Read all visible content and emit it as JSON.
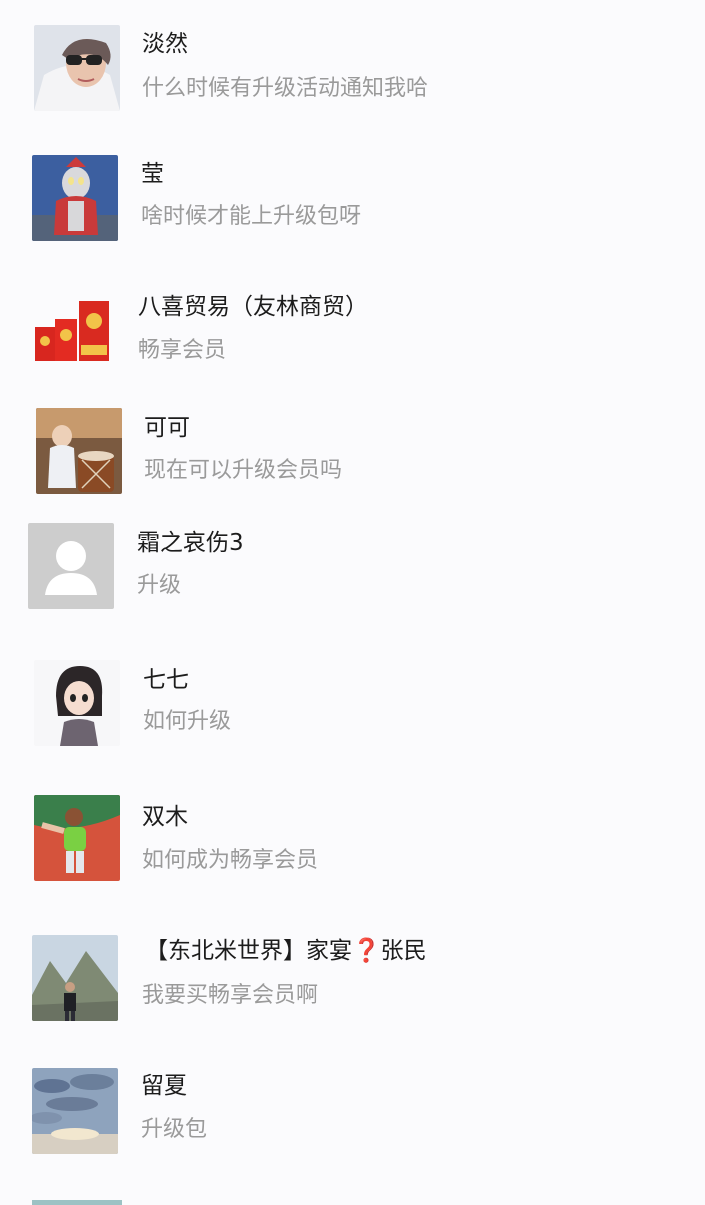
{
  "messages": [
    {
      "name": "淡然",
      "text": "什么时候有升级活动通知我哈",
      "avatar": "woman-sunglasses-avatar"
    },
    {
      "name": "莹",
      "text": "啥时候才能上升级包呀",
      "avatar": "ultraman-figure-avatar"
    },
    {
      "name": "八喜贸易（友林商贸）",
      "text": "畅享会员",
      "avatar": "red-envelopes-avatar"
    },
    {
      "name": "可可",
      "text": "现在可以升级会员吗",
      "avatar": "child-drum-avatar"
    },
    {
      "name": "霜之哀伤3",
      "text": "升级",
      "avatar": "default-person-avatar"
    },
    {
      "name": "七七",
      "text": "如何升级",
      "avatar": "cartoon-girl-avatar"
    },
    {
      "name": "双木",
      "text": "如何成为畅享会员",
      "avatar": "toddler-running-avatar"
    },
    {
      "name_prefix": "【东北米世界】家宴",
      "name_suffix": "张民",
      "text": "我要买畅享会员啊",
      "avatar": "mountain-man-avatar"
    },
    {
      "name": "留夏",
      "text": "升级包",
      "avatar": "cloudy-sky-avatar"
    }
  ]
}
